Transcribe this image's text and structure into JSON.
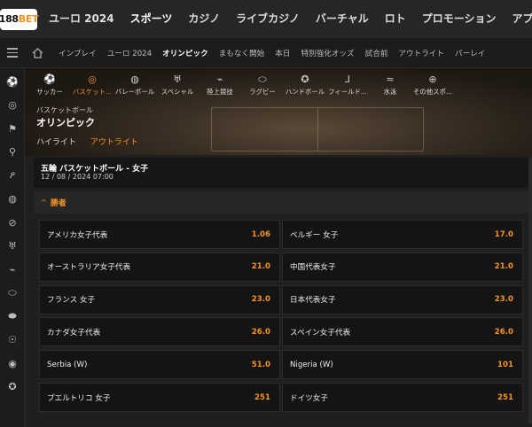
{
  "brand": {
    "logo_main": "188",
    "logo_accent": "BET"
  },
  "topnav": [
    "ユーロ 2024",
    "スポーツ",
    "カジノ",
    "ライブカジノ",
    "バーチャル",
    "ロト",
    "プロモーション",
    "アプリ"
  ],
  "subnav": [
    "インプレイ",
    "ユーロ 2024",
    "オリンピック",
    "まもなく開始",
    "本日",
    "特別強化オッズ",
    "試合前",
    "アウトライト",
    "パーレイ"
  ],
  "sidebar_icons": [
    "soccer-icon",
    "basketball-icon",
    "flag-icon",
    "sprint-icon",
    "running-icon",
    "volleyball-icon",
    "pingpong-icon",
    "trophy-icon",
    "sneaker-icon",
    "rugby-icon",
    "american-football-icon",
    "medal-icon",
    "target-icon",
    "handball-icon"
  ],
  "sports_bar": [
    {
      "label": "サッカー",
      "icon": "soccer-icon"
    },
    {
      "label": "バスケット...",
      "icon": "basketball-icon"
    },
    {
      "label": "バレーボール",
      "icon": "volleyball-icon"
    },
    {
      "label": "スペシャル",
      "icon": "trophy-icon"
    },
    {
      "label": "陸上競技",
      "icon": "sneaker-icon"
    },
    {
      "label": "ラグビー",
      "icon": "rugby-icon"
    },
    {
      "label": "ハンドボール",
      "icon": "handball-icon"
    },
    {
      "label": "フィールド...",
      "icon": "hockey-icon"
    },
    {
      "label": "水泳",
      "icon": "swimming-icon"
    },
    {
      "label": "その他スポ...",
      "icon": "plus-icon"
    }
  ],
  "hero": {
    "category": "バスケットボール",
    "title": "オリンピック",
    "tabs": [
      "ハイライト",
      "アウトライト"
    ]
  },
  "match": {
    "title": "五輪 バスケットボール - 女子",
    "datetime": "12 / 08 / 2024 07:00"
  },
  "market": {
    "name": "勝者"
  },
  "odds": [
    {
      "team": "アメリカ女子代表",
      "odds": "1.06"
    },
    {
      "team": "ベルギー 女子",
      "odds": "17.0"
    },
    {
      "team": "オーストラリア女子代表",
      "odds": "21.0"
    },
    {
      "team": "中国代表女子",
      "odds": "21.0"
    },
    {
      "team": "フランス 女子",
      "odds": "23.0"
    },
    {
      "team": "日本代表女子",
      "odds": "23.0"
    },
    {
      "team": "カナダ女子代表",
      "odds": "26.0"
    },
    {
      "team": "スペイン女子代表",
      "odds": "26.0"
    },
    {
      "team": "Serbia (W)",
      "odds": "51.0"
    },
    {
      "team": "Nigeria (W)",
      "odds": "101"
    },
    {
      "team": "プエルトリコ 女子",
      "odds": "251"
    },
    {
      "team": "ドイツ女子",
      "odds": "251"
    }
  ],
  "colors": {
    "accent": "#f7931e",
    "background": "#1f1f1f",
    "cell": "#141414"
  }
}
